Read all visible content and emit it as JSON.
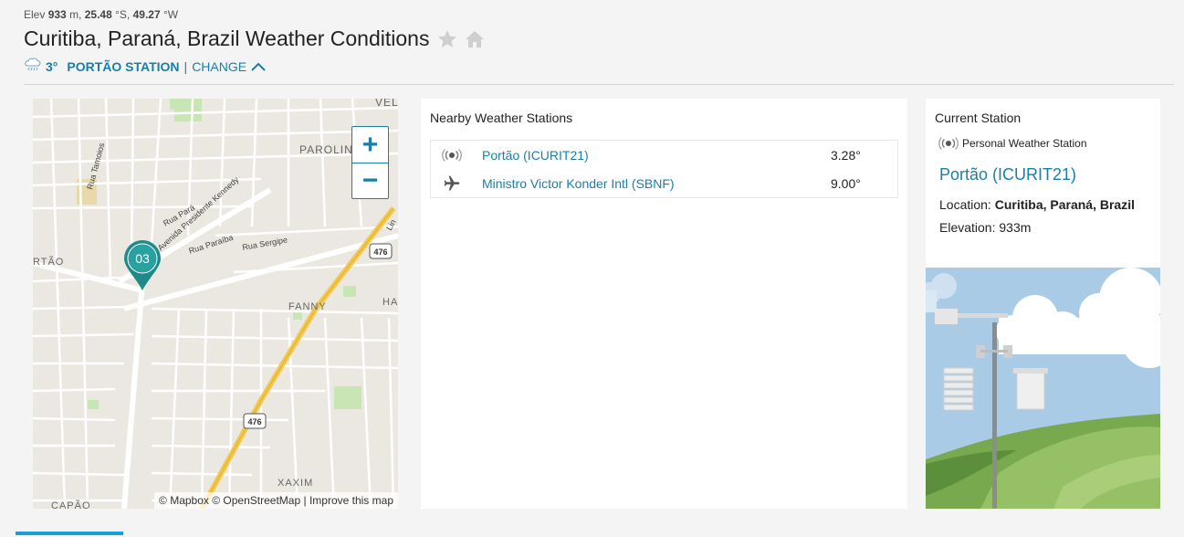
{
  "header": {
    "elev_label": "Elev",
    "elev_value": "933",
    "elev_unit": "m,",
    "lat_value": "25.48",
    "lat_unit": "°S,",
    "lon_value": "49.27",
    "lon_unit": "°W",
    "title": "Curitiba, Paraná, Brazil Weather Conditions",
    "temp": "3°",
    "station": "Portão Station",
    "separator": "|",
    "change_label": "CHANGE"
  },
  "map": {
    "labels": [
      "VEL",
      "PAROLIN",
      "Rua Tamoios",
      "Rua Pará",
      "Avenida Presidente Kennedy",
      "Rua Paraíba",
      "Rua Sergipe",
      "RTÃO",
      "FANNY",
      "HA",
      "XAXIM",
      "CAPÃO",
      "Lin"
    ],
    "road_shields": [
      "476",
      "476"
    ],
    "marker_label": "03",
    "zoom_in": "+",
    "zoom_out": "−",
    "attribution": {
      "mapbox": "© Mapbox",
      "osm": "© OpenStreetMap",
      "sep": "|",
      "improve": "Improve this map"
    }
  },
  "nearby": {
    "title": "Nearby Weather Stations",
    "stations": [
      {
        "icon": "pws-signal-icon",
        "name": "Portão (ICURIT21)",
        "temp": "3.28°"
      },
      {
        "icon": "airplane-icon",
        "name": "Ministro Victor Konder Intl (SBNF)",
        "temp": "9.00°"
      }
    ]
  },
  "current": {
    "title": "Current Station",
    "type": "Personal Weather Station",
    "name": "Portão (ICURIT21)",
    "location_label": "Location:",
    "location_value": "Curitiba, Paraná, Brazil",
    "elevation_label": "Elevation:",
    "elevation_value": "933m"
  },
  "colors": {
    "accent": "#1a7fa8",
    "marker": "#1f8a8a",
    "highway": "#f3c94f"
  }
}
